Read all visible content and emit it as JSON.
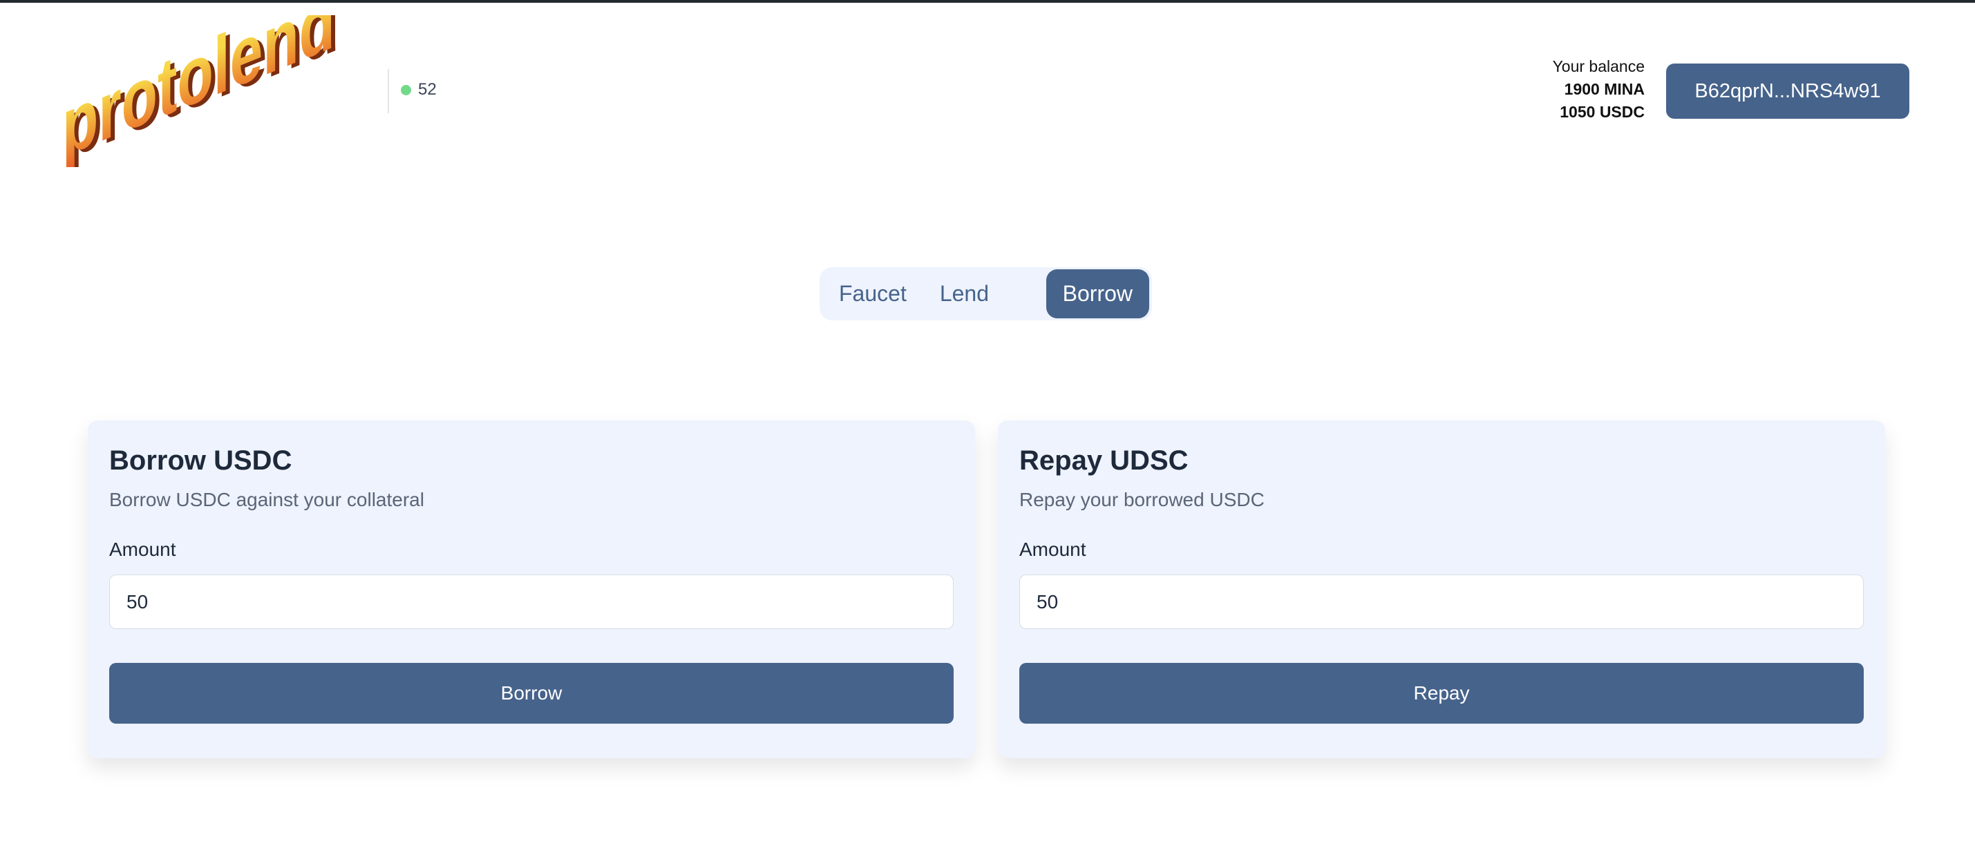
{
  "header": {
    "logo_text": "protolend",
    "block_height": "52",
    "status_color": "#72d98a",
    "balance_label": "Your balance",
    "balance_mina": "1900 MINA",
    "balance_usdc": "1050 USDC",
    "wallet_address": "B62qprN...NRS4w91"
  },
  "tabs": [
    {
      "label": "Faucet"
    },
    {
      "label": "Lend"
    },
    {
      "label": "Borrow",
      "active": true
    }
  ],
  "cards": [
    {
      "title": "Borrow USDC",
      "subtitle": "Borrow USDC against your collateral",
      "amount_label": "Amount",
      "amount_value": "50",
      "button": "Borrow"
    },
    {
      "title": "Repay UDSC",
      "subtitle": "Repay your borrowed USDC",
      "amount_label": "Amount",
      "amount_value": "50",
      "button": "Repay"
    }
  ],
  "colors": {
    "primary": "#46638b",
    "card_bg": "#eef3fd"
  }
}
